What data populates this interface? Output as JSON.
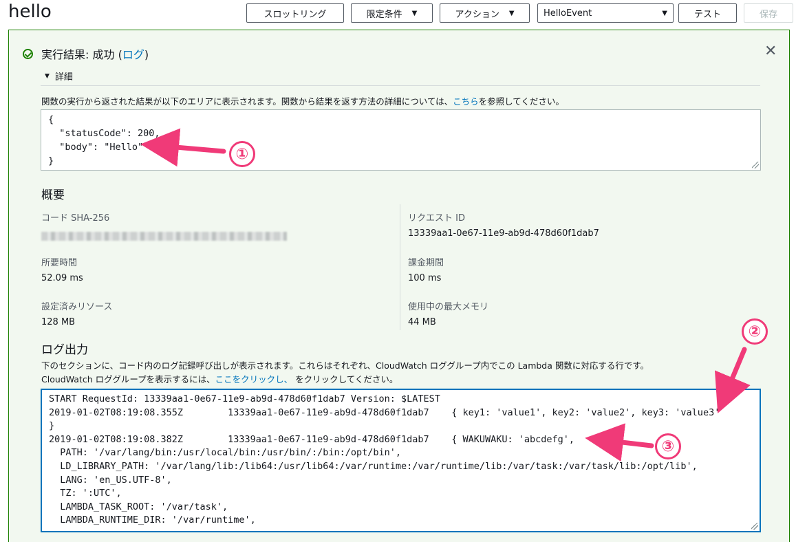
{
  "page": {
    "title": "hello"
  },
  "toolbar": {
    "throttling_label": "スロットリング",
    "qualifiers_label": "限定条件",
    "actions_label": "アクション",
    "test_event_value": "HelloEvent",
    "test_label": "テスト",
    "save_label": "保存"
  },
  "result": {
    "status_prefix": "実行結果: 成功 (",
    "log_link": "ログ",
    "status_suffix": ")",
    "details_label": "詳細",
    "description_before": "関数の実行から返された結果が以下のエリアに表示されます。関数から結果を返す方法の詳細については、",
    "description_link": "こちら",
    "description_after": "を参照してください。",
    "output_lines": [
      "{",
      "  \"statusCode\": 200,",
      "  \"body\": \"Hello\"",
      "}"
    ]
  },
  "summary": {
    "heading": "概要",
    "code_sha_label": "コード SHA-256",
    "request_id_label": "リクエスト ID",
    "request_id_value": "13339aa1-0e67-11e9-ab9d-478d60f1dab7",
    "duration_label": "所要時間",
    "duration_value": "52.09 ms",
    "billed_label": "課金期間",
    "billed_value": "100 ms",
    "resources_label": "設定済みリソース",
    "resources_value": "128 MB",
    "max_memory_label": "使用中の最大メモリ",
    "max_memory_value": "44 MB"
  },
  "log": {
    "heading": "ログ出力",
    "desc_line1": "下のセクションに、コード内のログ記録呼び出しが表示されます。これらはそれぞれ、CloudWatch ロググループ内でこの Lambda 関数に対応する行です。",
    "desc_line2_before": "CloudWatch ロググループを表示するには、",
    "desc_line2_link": "ここをクリックし、",
    "desc_line2_after": " をクリックしてください。",
    "lines": [
      "START RequestId: 13339aa1-0e67-11e9-ab9d-478d60f1dab7 Version: $LATEST",
      "2019-01-02T08:19:08.355Z        13339aa1-0e67-11e9-ab9d-478d60f1dab7    { key1: 'value1', key2: 'value2', key3: 'value3'",
      "}",
      "2019-01-02T08:19:08.382Z        13339aa1-0e67-11e9-ab9d-478d60f1dab7    { WAKUWAKU: 'abcdefg',",
      "  PATH: '/var/lang/bin:/usr/local/bin:/usr/bin/:/bin:/opt/bin',",
      "  LD_LIBRARY_PATH: '/var/lang/lib:/lib64:/usr/lib64:/var/runtime:/var/runtime/lib:/var/task:/var/task/lib:/opt/lib',",
      "  LANG: 'en_US.UTF-8',",
      "  TZ: ':UTC',",
      "  LAMBDA_TASK_ROOT: '/var/task',",
      "  LAMBDA_RUNTIME_DIR: '/var/runtime',"
    ]
  },
  "annotations": {
    "one": "①",
    "two": "②",
    "three": "③",
    "color": "#f03a78"
  },
  "colors": {
    "success": "#1d8102",
    "link": "#0073bb",
    "panel_bg": "#f2f8f0"
  }
}
